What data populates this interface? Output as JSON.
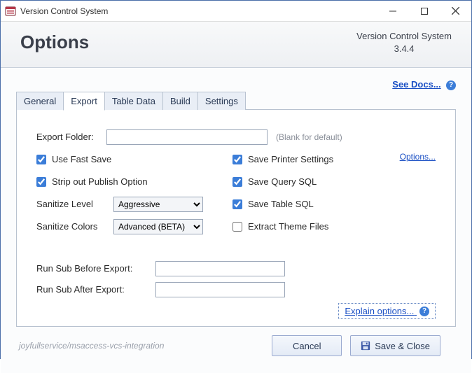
{
  "window": {
    "title": "Version Control System"
  },
  "header": {
    "title": "Options",
    "product": "Version Control System",
    "version": "3.4.4"
  },
  "links": {
    "see_docs": "See Docs...",
    "options": "Options...",
    "explain": "Explain options..."
  },
  "tabs": {
    "general": "General",
    "export": "Export",
    "table_data": "Table Data",
    "build": "Build",
    "settings": "Settings"
  },
  "export": {
    "folder_label": "Export Folder:",
    "folder_value": "",
    "folder_hint": "(Blank for default)",
    "use_fast_save": "Use Fast Save",
    "strip_publish": "Strip out Publish Option",
    "sanitize_level_label": "Sanitize Level",
    "sanitize_level_value": "Aggressive",
    "sanitize_colors_label": "Sanitize Colors",
    "sanitize_colors_value": "Advanced (BETA)",
    "save_printer": "Save Printer Settings",
    "save_query_sql": "Save Query SQL",
    "save_table_sql": "Save Table SQL",
    "extract_theme": "Extract Theme Files",
    "run_before_label": "Run Sub Before Export:",
    "run_before_value": "",
    "run_after_label": "Run Sub After Export:",
    "run_after_value": ""
  },
  "footer": {
    "repo": "joyfullservice/msaccess-vcs-integration",
    "cancel": "Cancel",
    "save_close": "Save & Close"
  }
}
